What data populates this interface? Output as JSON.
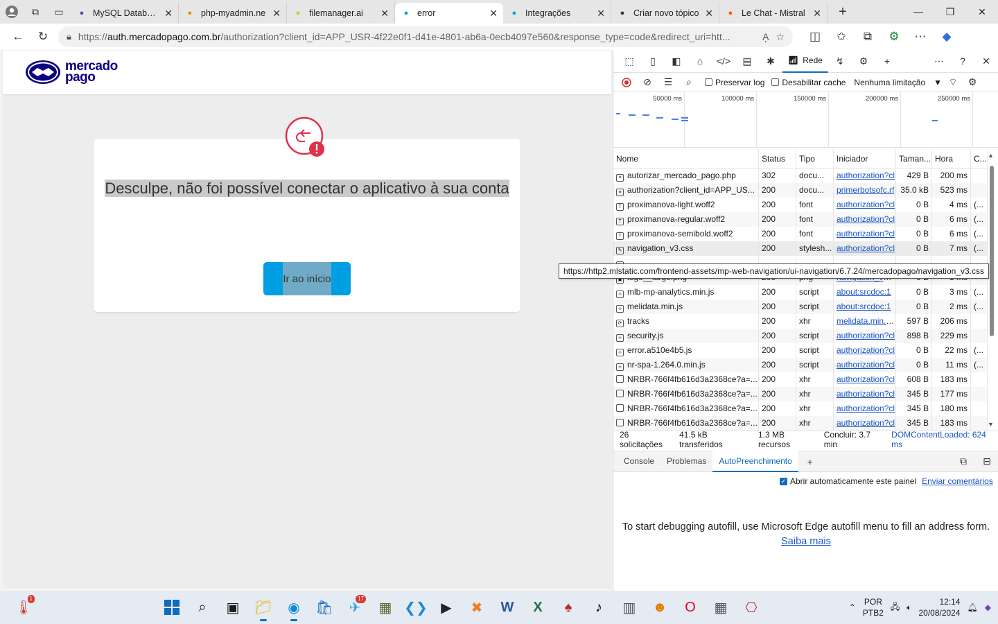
{
  "browser": {
    "tabs": [
      {
        "title": "MySQL Database",
        "icon": "infinity-icon",
        "color": "#6b3fa0"
      },
      {
        "title": "php-myadmin.ne",
        "icon": "pma-icon",
        "color": "#f08a00"
      },
      {
        "title": "filemanager.ai",
        "icon": "filemanager-icon",
        "color": "#c9c93a"
      },
      {
        "title": "error",
        "icon": "mercadopago-icon",
        "color": "#009ee3",
        "active": true
      },
      {
        "title": "Integrações",
        "icon": "mercadopago-icon",
        "color": "#009ee3"
      },
      {
        "title": "Criar novo tópico",
        "icon": "forum-icon",
        "color": "#333"
      },
      {
        "title": "Le Chat - Mistral",
        "icon": "mistral-icon",
        "color": "#f25c05"
      }
    ],
    "url_scheme": "https://",
    "url_host": "auth.mercadopago.com.br",
    "url_rest": "/authorization?client_id=APP_USR-4f22e0f1-d41e-4801-ab6a-0ecb4097e560&response_type=code&redirect_uri=htt..."
  },
  "page": {
    "logo_line1": "mercado",
    "logo_line2": "pago",
    "error_title": "Desculpe, não foi possível conectar o aplicativo à sua conta",
    "home_button": "Ir ao início"
  },
  "devtools": {
    "network_tab": "Rede",
    "preserve_log": "Preservar log",
    "disable_cache": "Desabilitar cache",
    "throttling": "Nenhuma limitação",
    "timeline_ticks": [
      "50000 ms",
      "100000 ms",
      "150000 ms",
      "200000 ms",
      "250000 ms"
    ],
    "columns": [
      "Nome",
      "Status",
      "Tipo",
      "Iniciador",
      "Taman...",
      "Hora",
      "C..."
    ],
    "rows": [
      {
        "name": "autorizar_mercado_pago.php",
        "status": "302",
        "type": "docu...",
        "initiator": "authorization?cl",
        "size": "429 B",
        "time": "200 ms",
        "c": "",
        "icon": "doc"
      },
      {
        "name": "authorization?client_id=APP_US...",
        "status": "200",
        "type": "docu...",
        "initiator": "primerbotsofc.rf",
        "size": "35.0 kB",
        "time": "523 ms",
        "c": "",
        "icon": "doc"
      },
      {
        "name": "proximanova-light.woff2",
        "status": "200",
        "type": "font",
        "initiator": "authorization?cl",
        "size": "0 B",
        "time": "4 ms",
        "c": "(...",
        "icon": "font"
      },
      {
        "name": "proximanova-regular.woff2",
        "status": "200",
        "type": "font",
        "initiator": "authorization?cl",
        "size": "0 B",
        "time": "6 ms",
        "c": "(...",
        "icon": "font"
      },
      {
        "name": "proximanova-semibold.woff2",
        "status": "200",
        "type": "font",
        "initiator": "authorization?cl",
        "size": "0 B",
        "time": "6 ms",
        "c": "(...",
        "icon": "font"
      },
      {
        "name": "navigation_v3.css",
        "status": "200",
        "type": "stylesh...",
        "initiator": "authorization?cl",
        "size": "0 B",
        "time": "7 ms",
        "c": "(...",
        "icon": "css"
      },
      {
        "name": "",
        "status": "",
        "type": "",
        "initiator": "",
        "size": "",
        "time": "",
        "c": "",
        "icon": "css"
      },
      {
        "name": "logo__large.png",
        "status": "200",
        "type": "png",
        "initiator": "navigation_v3.cs",
        "size": "0 B",
        "time": "1 ms",
        "c": "",
        "icon": "img"
      },
      {
        "name": "mlb-mp-analytics.min.js",
        "status": "200",
        "type": "script",
        "initiator": "about:srcdoc:1",
        "size": "0 B",
        "time": "3 ms",
        "c": "(...",
        "icon": "js"
      },
      {
        "name": "melidata.min.js",
        "status": "200",
        "type": "script",
        "initiator": "about:srcdoc:1",
        "size": "0 B",
        "time": "2 ms",
        "c": "(...",
        "icon": "js"
      },
      {
        "name": "tracks",
        "status": "200",
        "type": "xhr",
        "initiator": "melidata.min.js:1",
        "size": "597 B",
        "time": "206 ms",
        "c": "",
        "icon": "xhr"
      },
      {
        "name": "security.js",
        "status": "200",
        "type": "script",
        "initiator": "authorization?cl",
        "size": "898 B",
        "time": "229 ms",
        "c": "",
        "icon": "js"
      },
      {
        "name": "error.a510e4b5.js",
        "status": "200",
        "type": "script",
        "initiator": "authorization?cl",
        "size": "0 B",
        "time": "22 ms",
        "c": "(...",
        "icon": "js"
      },
      {
        "name": "nr-spa-1.264.0.min.js",
        "status": "200",
        "type": "script",
        "initiator": "authorization?cl",
        "size": "0 B",
        "time": "11 ms",
        "c": "(...",
        "icon": "js"
      },
      {
        "name": "NRBR-766f4fb616d3a2368ce?a=...",
        "status": "200",
        "type": "xhr",
        "initiator": "authorization?cl",
        "size": "608 B",
        "time": "183 ms",
        "c": "",
        "icon": "file"
      },
      {
        "name": "NRBR-766f4fb616d3a2368ce?a=...",
        "status": "200",
        "type": "xhr",
        "initiator": "authorization?cl",
        "size": "345 B",
        "time": "177 ms",
        "c": "",
        "icon": "file"
      },
      {
        "name": "NRBR-766f4fb616d3a2368ce?a=...",
        "status": "200",
        "type": "xhr",
        "initiator": "authorization?cl",
        "size": "345 B",
        "time": "180 ms",
        "c": "",
        "icon": "file"
      },
      {
        "name": "NRBR-766f4fb616d3a2368ce?a=...",
        "status": "200",
        "type": "xhr",
        "initiator": "authorization?cl",
        "size": "345 B",
        "time": "183 ms",
        "c": "",
        "icon": "file"
      }
    ],
    "tooltip": "https://http2.mlstatic.com/frontend-assets/mp-web-navigation/ui-navigation/6.7.24/mercadopago/navigation_v3.css",
    "summary": {
      "requests": "26 solicitações",
      "transferred": "41.5 kB transferidos",
      "resources": "1.3 MB recursos",
      "finish": "Concluir: 3.7 min",
      "dcl": "DOMContentLoaded: 624 ms"
    },
    "drawer_tabs": [
      "Console",
      "Problemas",
      "AutoPreenchimento"
    ],
    "autofill_checkbox": "Abrir automaticamente este painel",
    "feedback_link": "Enviar comentários",
    "autofill_message": "To start debugging autofill, use Microsoft Edge autofill menu to fill an address form.",
    "learn_more": "Saiba mais"
  },
  "taskbar": {
    "weather_badge": "1",
    "telegram_badge": "17",
    "lang_line1": "POR",
    "lang_line2": "PTB2",
    "time": "12:14",
    "date": "20/08/2024"
  }
}
